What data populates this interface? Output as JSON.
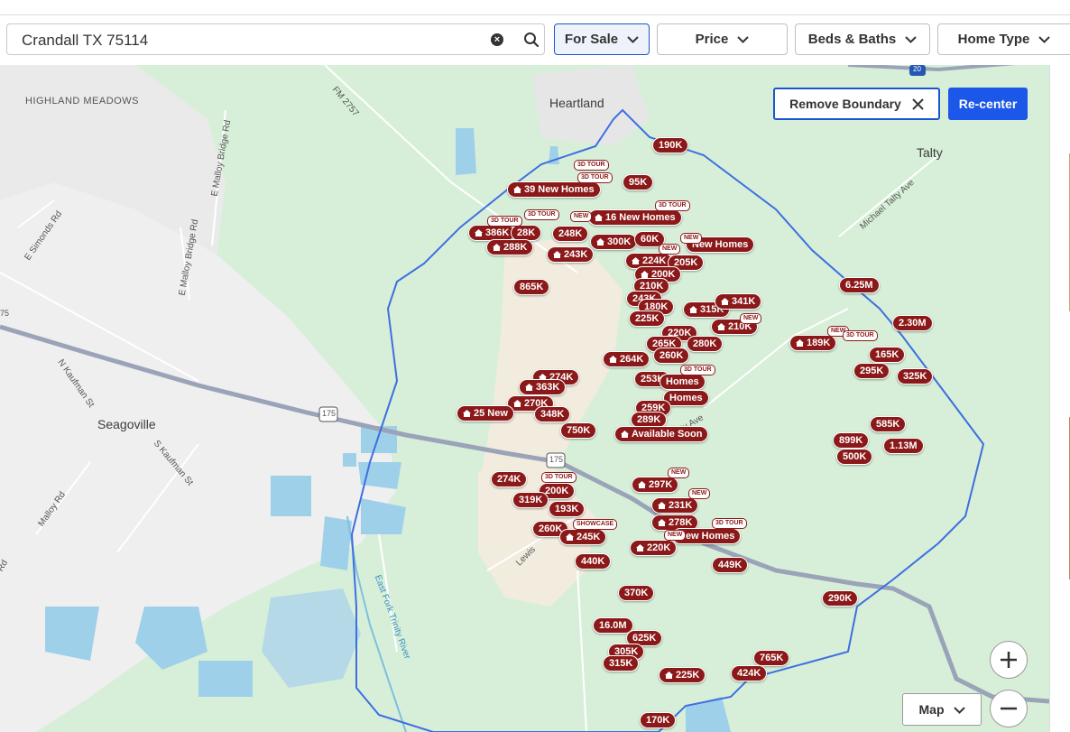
{
  "search": {
    "value": "Crandall TX 75114",
    "clear_icon": "clear-icon",
    "search_icon": "search-icon"
  },
  "filters": [
    {
      "label": "For Sale",
      "active": true
    },
    {
      "label": "Price",
      "active": false
    },
    {
      "label": "Beds & Baths",
      "active": false
    },
    {
      "label": "Home Type",
      "active": false
    }
  ],
  "map": {
    "remove_boundary": "Remove Boundary",
    "recenter": "Re-center",
    "map_type": "Map",
    "zoom_in": "+",
    "zoom_out": "−",
    "colors": {
      "pin": "#8c1919",
      "boundary": "#3d6fe0",
      "accent": "#1b57e8",
      "land": "#d7efd9",
      "water": "#9fd0ea"
    },
    "places": {
      "highland_meadows": "HIGHLAND MEADOWS",
      "heartland": "Heartland",
      "talty": "Talty",
      "seagoville": "Seagoville"
    },
    "roads": {
      "fm2757": "FM 2757",
      "e_malloy_bridge_1": "E Malloy Bridge Rd",
      "e_simonds": "E Simonds Rd",
      "e_malloy_bridge_2": "E Malloy Bridge Rd",
      "michael_talty": "Michael Talty Ave",
      "n_kaufman": "N Kaufman St",
      "s_kaufman": "S Kaufman St",
      "malloy": "Malloy Rd",
      "east_fork": "East Fork Trinity River",
      "lewis": "Lewis",
      "talty_ave_2": "M Talty Ave",
      "i20": "20",
      "us175a": "175",
      "us175b": "175",
      "edge_left": "75",
      "edge_rd": "Rd"
    },
    "pins": {
      "p190": "190K",
      "p95": "95K",
      "p39": "39 New Homes",
      "p16": "16 New Homes",
      "p386": "386K",
      "p28": "28K",
      "p248": "248K",
      "p288": "288K",
      "p243": "243K",
      "p300": "300K",
      "p60": "60K",
      "pnh1": "New Homes",
      "p224": "224K",
      "p205": "205K",
      "p200a": "200K",
      "p210a": "210K",
      "p865": "865K",
      "p243b": "243K",
      "p180": "180K",
      "p225a": "225K",
      "p315": "315K",
      "p341": "341K",
      "p220a": "220K",
      "p210b": "210K",
      "p265": "265K",
      "p280": "280K",
      "p260": "260K",
      "p264": "264K",
      "p253": "253K",
      "pnh2": "Homes",
      "pnh3": "Homes",
      "p274a": "274K",
      "p363": "363K",
      "p270": "270K",
      "p25": "25 New",
      "p348": "348K",
      "p259": "259K",
      "p289": "289K",
      "p750": "750K",
      "pavail": "Available Soon",
      "p625": "6.25M",
      "p230m": "2.30M",
      "p189": "189K",
      "p165": "165K",
      "p295": "295K",
      "p325": "325K",
      "p585": "585K",
      "p899": "899K",
      "p113m": "1.13M",
      "p500": "500K",
      "p274b": "274K",
      "p200b": "200K",
      "p319": "319K",
      "p193": "193K",
      "p297": "297K",
      "p231": "231K",
      "p278": "278K",
      "pnh4": "New Homes",
      "p260b": "260K",
      "p245": "245K",
      "p220b": "220K",
      "p440": "440K",
      "p449": "449K",
      "p370": "370K",
      "p290": "290K",
      "p16m": "16.0M",
      "p625k": "625K",
      "p305": "305K",
      "p315b": "315K",
      "p765": "765K",
      "p424": "424K",
      "p225b": "225K",
      "p170": "170K"
    },
    "badges": {
      "b1": "3D TOUR",
      "b2": "3D TOUR",
      "b3": "3D TOUR",
      "b4": "3D TOUR",
      "b5": "3D TOUR",
      "b6": "NEW",
      "b7": "NEW",
      "b8": "NEW",
      "b9": "3D TOUR",
      "b10": "NEW",
      "b11": "3D TOUR",
      "b12": "NEW",
      "b13": "3D TOUR",
      "b14": "NEW",
      "b15": "SHOWCASE",
      "b16": "NEW",
      "b17": "3D TOUR",
      "b18": "NEW"
    }
  }
}
